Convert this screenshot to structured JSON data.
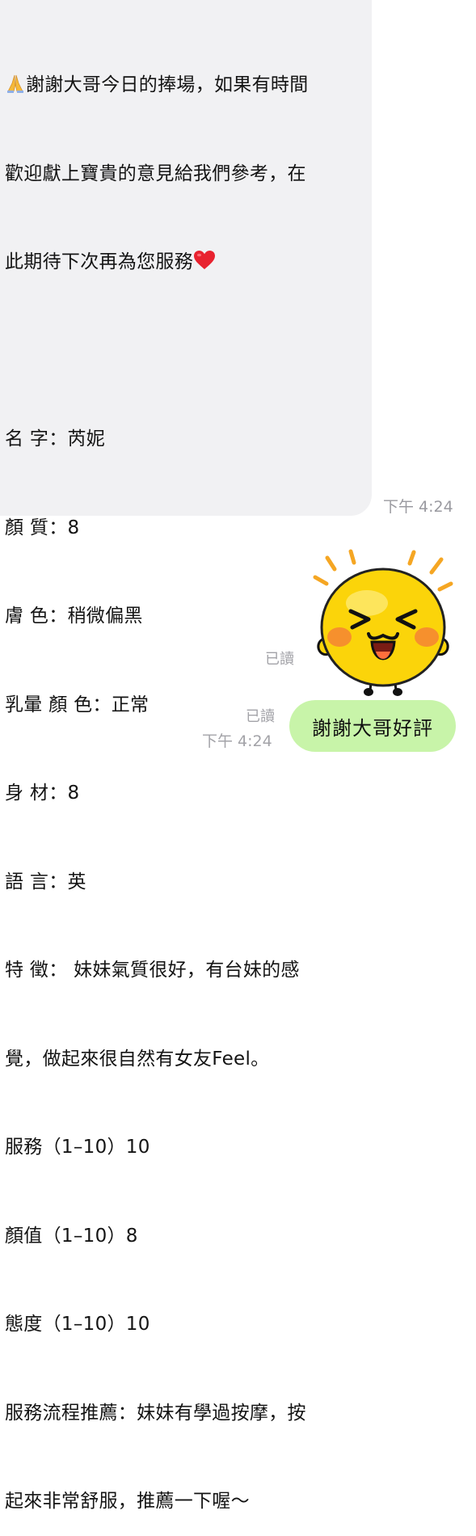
{
  "colors": {
    "incoming_bubble": "#f1f1f3",
    "outgoing_bubble": "#c8f4a9",
    "meta_text": "#a3a3a8"
  },
  "incoming": {
    "leading_emoji": "folded-hands",
    "trailing_emoji": "red-heart",
    "line1": "謝謝大哥今日的捧場，如果有時間",
    "line2": "歡迎獻上寶貴的意見給我們參考，在",
    "line3": "此期待下次再為您服務",
    "line_blank": "",
    "line5": "名 字：芮妮",
    "line6": "顏 質：8",
    "line7": "膚 色：稍微偏黑",
    "line8": "乳暈 顏 色：正常",
    "line9": "身 材：8",
    "line10": "語 言：英",
    "line11": "特 徵： 妹妹氣質很好，有台妹的感",
    "line12": "覺，做起來很自然有女友Feel。",
    "line13": "服務（1–10）10",
    "line14": "顏值（1–10）8",
    "line15": "態度（1–10）10",
    "line16": "服務流程推薦：妹妹有學過按摩，按",
    "line17": "起來非常舒服，推薦一下喔～",
    "time": "下午 4:24"
  },
  "sticker": {
    "icon": "laughing-sun-sticker",
    "read_status": "已讀"
  },
  "outgoing": {
    "text": "謝謝大哥好評",
    "read_status": "已讀",
    "time": "下午 4:24"
  }
}
